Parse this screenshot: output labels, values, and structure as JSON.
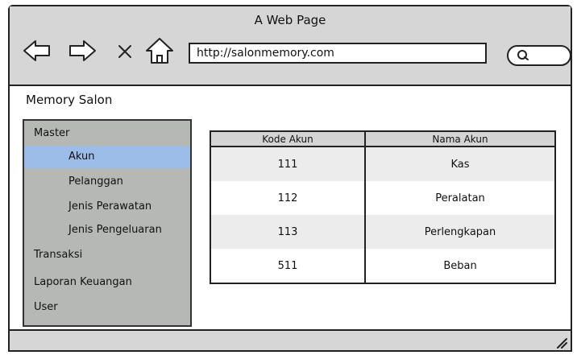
{
  "window": {
    "title": "A Web Page"
  },
  "toolbar": {
    "url": "http://salonmemory.com"
  },
  "page": {
    "title": "Memory Salon"
  },
  "sidebar": {
    "items": [
      {
        "label": "Master"
      },
      {
        "label": "Akun"
      },
      {
        "label": "Pelanggan"
      },
      {
        "label": "Jenis Perawatan"
      },
      {
        "label": "Jenis Pengeluaran"
      },
      {
        "label": "Transaksi"
      },
      {
        "label": "Laporan Keuangan"
      },
      {
        "label": "User"
      }
    ],
    "active": "Akun",
    "active_color": "#9bbde8"
  },
  "table": {
    "headers": [
      "Kode Akun",
      "Nama Akun"
    ],
    "rows": [
      [
        "111",
        "Kas"
      ],
      [
        "112",
        "Peralatan"
      ],
      [
        "113",
        "Perlengkapan"
      ],
      [
        "511",
        "Beban"
      ]
    ]
  },
  "colors": {
    "chrome": "#d6d6d6",
    "sidebar": "#b5b8b4",
    "header": "#d4d4d4"
  },
  "icons": [
    "back-arrow-icon",
    "forward-arrow-icon",
    "close-icon",
    "home-icon",
    "search-icon",
    "resize-grip-icon"
  ]
}
